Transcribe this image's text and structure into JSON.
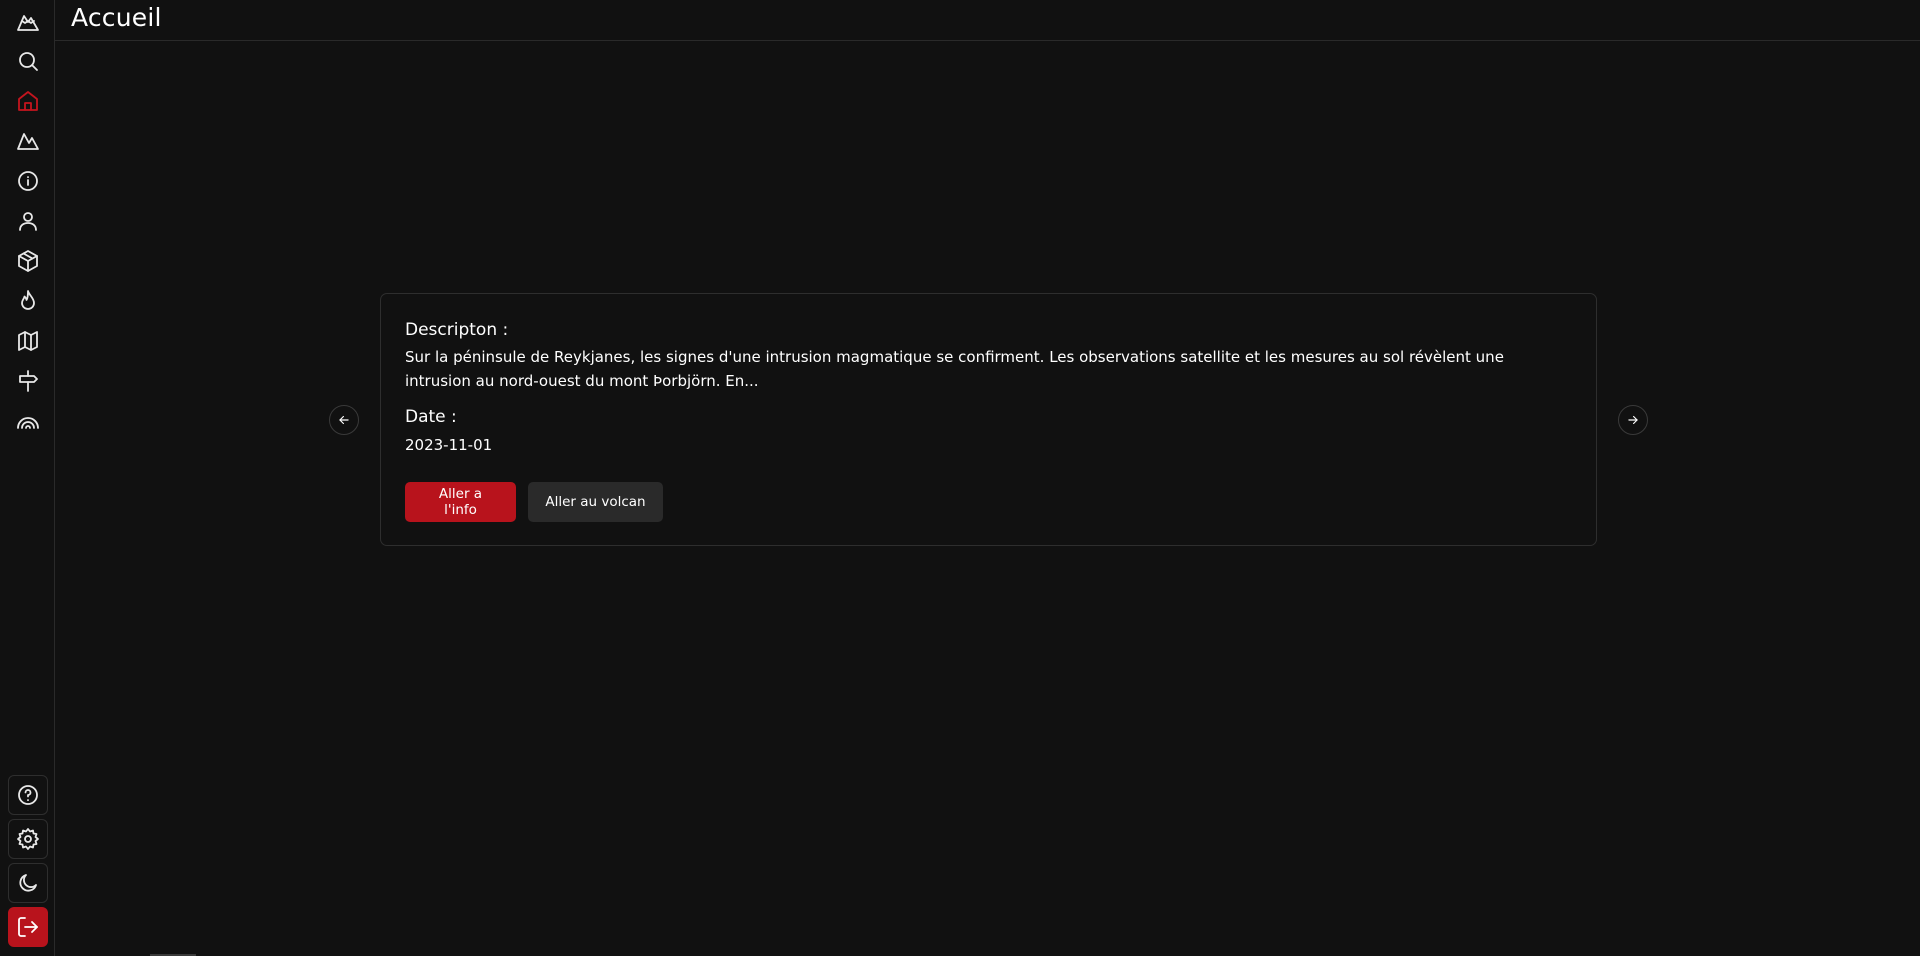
{
  "header": {
    "title": "Accueil"
  },
  "sidebar": {
    "top_items": [
      {
        "icon": "volcano-logo-icon"
      },
      {
        "icon": "search-icon"
      },
      {
        "icon": "home-icon",
        "active": true
      },
      {
        "icon": "mountain-icon"
      },
      {
        "icon": "info-icon"
      },
      {
        "icon": "user-icon"
      },
      {
        "icon": "package-icon"
      },
      {
        "icon": "flame-icon"
      },
      {
        "icon": "map-icon"
      },
      {
        "icon": "signpost-icon"
      },
      {
        "icon": "rainbow-icon"
      }
    ],
    "bottom_items": [
      {
        "icon": "help-icon"
      },
      {
        "icon": "settings-icon"
      },
      {
        "icon": "moon-icon"
      },
      {
        "icon": "logout-icon"
      }
    ]
  },
  "card": {
    "description_label": "Descripton :",
    "description_text": "Sur la péninsule de Reykjanes, les signes d'une intrusion magmatique se confirment. Les observations satellite et les mesures au sol révèlent une intrusion au nord-ouest du mont Þorbjörn. En...",
    "date_label": "Date :",
    "date_value": "2023-11-01",
    "primary_button": "Aller a l'info",
    "secondary_button": "Aller au volcan"
  },
  "carousel": {
    "prev_icon": "arrow-left-icon",
    "next_icon": "arrow-right-icon"
  },
  "colors": {
    "background": "#111111",
    "accent": "#b8131c",
    "active_icon": "#c4141e",
    "secondary_button": "#2a2a2a",
    "border": "#2e2e2e"
  }
}
